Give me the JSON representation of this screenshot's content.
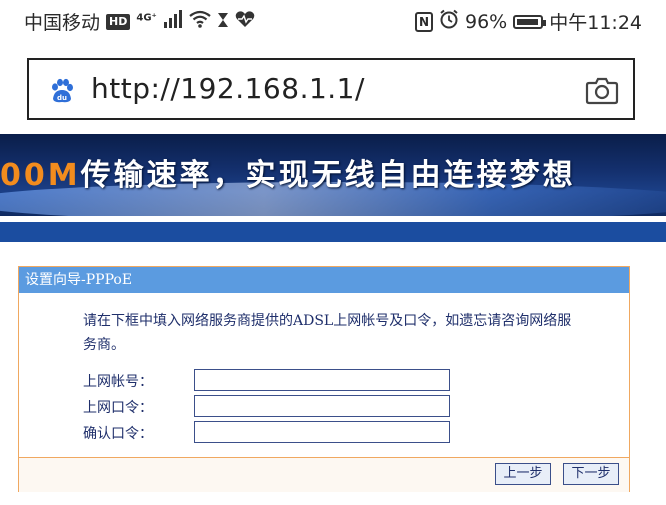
{
  "status_bar": {
    "carrier": "中国移动",
    "hd_badge": "HD",
    "network_type": "4G⁺",
    "battery_percent": "96%",
    "battery_level": 0.96,
    "time": "中午11:24",
    "nfc_label": "N"
  },
  "browser": {
    "url": "http://192.168.1.1/",
    "site_icon": "baidu-paw-icon",
    "camera_icon": "camera-icon"
  },
  "banner": {
    "text_prefix": "00M",
    "text_main": "传输速率，实现无线自由连接梦想"
  },
  "dialog": {
    "title": "设置向导-PPPoE",
    "description": "请在下框中填入网络服务商提供的ADSL上网帐号及口令，如遗忘请咨询网络服务商。",
    "fields": [
      {
        "label": "上网帐号：",
        "value": ""
      },
      {
        "label": "上网口令：",
        "value": ""
      },
      {
        "label": "确认口令：",
        "value": ""
      }
    ],
    "buttons": {
      "prev": "上一步",
      "next": "下一步"
    }
  },
  "colors": {
    "dialog_title_bg": "#5b9be0",
    "dialog_border": "#f0a860",
    "banner_orange": "#f28c1e",
    "banner_bg": "#14306e"
  }
}
